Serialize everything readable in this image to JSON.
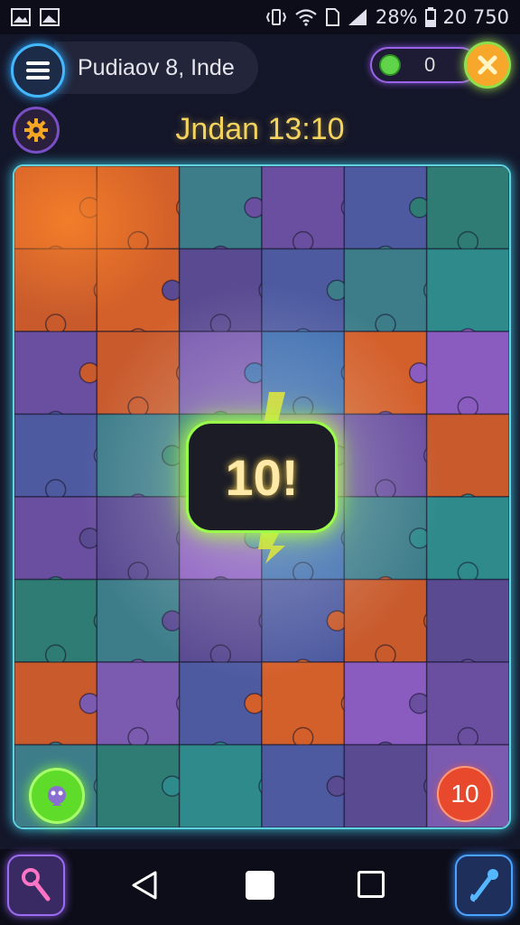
{
  "status_bar": {
    "battery": "28%",
    "clock": "20 750",
    "icons": [
      "image-icon",
      "gallery-icon",
      "vibrate-icon",
      "wifi-icon",
      "sim-icon",
      "signal-icon",
      "battery-icon"
    ]
  },
  "header": {
    "title": "Pudiaov 8, Inde",
    "score": "0",
    "menu_icon": "hamburger-menu-icon",
    "close_icon": "close-icon",
    "coin_icon": "coin-icon"
  },
  "level": {
    "title": "Jndan 13:10",
    "settings_icon": "gear-icon"
  },
  "board": {
    "badge_text": "10!",
    "moves_left": "10",
    "hint_icon": "hint-icon",
    "border_color": "#5fd3e0"
  },
  "nav": {
    "left_tool_icon": "key-icon",
    "back_icon": "back-icon",
    "home_icon": "home-icon",
    "recent_icon": "recent-apps-icon",
    "right_tool_icon": "brush-icon"
  },
  "colors": {
    "accent_blue": "#43b8ff",
    "accent_green": "#9aff4a",
    "title_gold": "#f4d35e",
    "moves_red": "#e8482c"
  }
}
